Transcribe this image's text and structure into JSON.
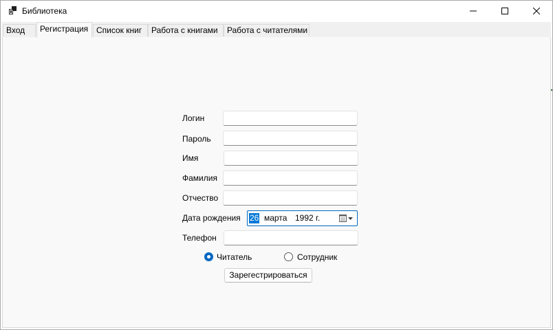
{
  "window": {
    "title": "Библиотека",
    "icon": "app-icon",
    "controls": [
      "minimize-icon",
      "maximize-icon",
      "close-icon"
    ]
  },
  "tabs": [
    {
      "label": "Вход",
      "active": false
    },
    {
      "label": "Регистрация",
      "active": true
    },
    {
      "label": "Список книг",
      "active": false
    },
    {
      "label": "Работа с книгами",
      "active": false
    },
    {
      "label": "Работа с читателями",
      "active": false
    }
  ],
  "form": {
    "login": {
      "label": "Логин",
      "value": ""
    },
    "password": {
      "label": "Пароль",
      "value": ""
    },
    "first_name": {
      "label": "Имя",
      "value": ""
    },
    "last_name": {
      "label": "Фамилия",
      "value": ""
    },
    "patronymic": {
      "label": "Отчество",
      "value": ""
    },
    "birth_date": {
      "label": "Дата рождения",
      "day": "26",
      "month": "марта",
      "year": "1992 г.",
      "icon": "calendar-dropdown-icon"
    },
    "phone": {
      "label": "Телефон",
      "value": ""
    },
    "role": {
      "options": [
        {
          "label": "Читатель",
          "selected": true
        },
        {
          "label": "Сотрудник",
          "selected": false
        }
      ]
    },
    "submit_label": "Зарегестрироваться"
  },
  "colors": {
    "accent": "#0067c0",
    "selection": "#0078d7",
    "page_background": "#f9f9f9"
  }
}
